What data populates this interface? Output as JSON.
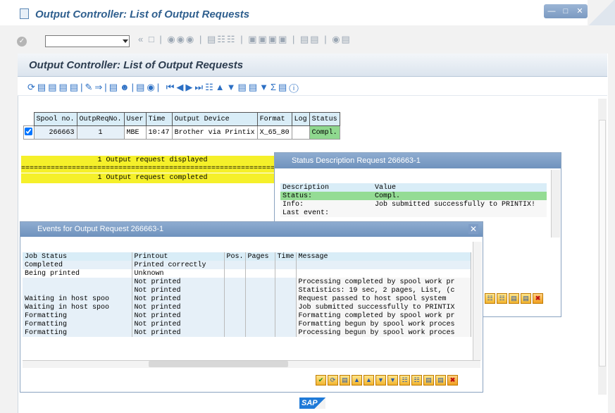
{
  "window": {
    "title": "Output Controller: List of Output Requests"
  },
  "screen": {
    "title": "Output Controller: List of Output Requests"
  },
  "list": {
    "headers": [
      "Spool no.",
      "OutpReqNo.",
      "User",
      "Time",
      "Output Device",
      "Format",
      "Log",
      "Status"
    ],
    "row": {
      "spool": "266663",
      "req": "1",
      "user": "MBE",
      "time": "10:47",
      "device": "Brother via Printix",
      "format": "X_65_80",
      "log": "",
      "status": "Compl."
    }
  },
  "messages": {
    "line1": "1 Output request displayed",
    "dashes": "============================================================================",
    "line2": "1 Output request completed"
  },
  "status_popup": {
    "title": "Status Description Request 266663-1",
    "header": [
      "Description",
      "Value"
    ],
    "rows": [
      [
        "Status:",
        "Compl."
      ],
      [
        "Info:",
        "Job submitted successfully to PRINTIX!"
      ],
      [
        "Last event:",
        ""
      ]
    ]
  },
  "events_popup": {
    "title": "Events for Output Request 266663-1",
    "header": [
      "Job Status",
      "Printout",
      "Pos.",
      "Pages",
      "Time",
      "Message"
    ],
    "rows": [
      [
        "Completed",
        "Printed correctly",
        "",
        "",
        "",
        ""
      ],
      [
        "Being printed",
        "Unknown",
        "",
        "",
        "",
        ""
      ],
      [
        "",
        "Not printed",
        "",
        "",
        "",
        "Processing completed by spool work pr"
      ],
      [
        "",
        "Not printed",
        "",
        "",
        "",
        "Statistics: 19 sec, 2 pages, List, (c"
      ],
      [
        "Waiting in host spoo",
        "Not printed",
        "",
        "",
        "",
        "Request passed to host spool system"
      ],
      [
        "Waiting in host spoo",
        "Not printed",
        "",
        "",
        "",
        "Job submitted successfully to PRINTIX"
      ],
      [
        "Formatting",
        "Not printed",
        "",
        "",
        "",
        "Formatting completed by spool work pr"
      ],
      [
        "Formatting",
        "Not printed",
        "",
        "",
        "",
        "Formatting begun by spool work proces"
      ],
      [
        "Formatting",
        "Not printed",
        "",
        "",
        "",
        "Processing begun by spool work proces"
      ]
    ]
  },
  "icons": {
    "ok": "check-icon",
    "close": "close-icon",
    "refresh": "refresh-icon",
    "find": "binoculars-icon",
    "print": "printer-icon"
  },
  "branding": {
    "logo": "SAP"
  },
  "colors": {
    "status_green": "#8fd98f",
    "header_blue": "#d9edf7",
    "message_yellow": "#f5f02a",
    "popup_title": "#6f92bd"
  }
}
